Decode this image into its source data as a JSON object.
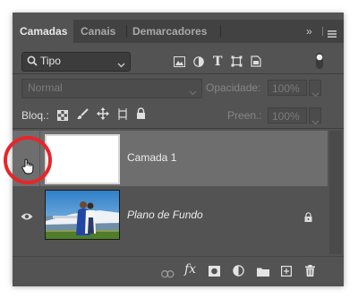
{
  "tabs": [
    {
      "label": "Camadas",
      "active": true
    },
    {
      "label": "Canais",
      "active": false
    },
    {
      "label": "Demarcadores",
      "active": false
    }
  ],
  "tab_controls": {
    "expand": "»",
    "menu_icon": "hamburger-menu-icon"
  },
  "filter": {
    "kind_label": "Tipo",
    "icons": [
      "image-filter-icon",
      "adjustment-filter-icon",
      "type-filter-icon",
      "shape-filter-icon",
      "smart-object-filter-icon",
      "filter-toggle-icon"
    ]
  },
  "blend": {
    "mode": "Normal",
    "opacity_label": "Opacidade:",
    "opacity_value": "100%"
  },
  "lock": {
    "label": "Bloq.:",
    "icons": [
      "lock-transparent-icon",
      "lock-image-icon",
      "lock-position-icon",
      "lock-artboard-icon",
      "lock-all-icon"
    ],
    "fill_label": "Preen.:",
    "fill_value": "100%"
  },
  "layers": [
    {
      "name": "Camada 1",
      "selected": true,
      "visible": true,
      "locked": false
    },
    {
      "name": "Plano de Fundo",
      "selected": false,
      "visible": true,
      "locked": true
    }
  ],
  "footer_icons": [
    "link-layers-icon",
    "fx-icon",
    "layer-mask-icon",
    "adjustment-layer-icon",
    "group-folder-icon",
    "new-layer-icon",
    "delete-layer-icon"
  ],
  "fx_label": "fx",
  "colors": {
    "annotation_ring": "#e8252a",
    "panel_bg": "#535353",
    "selected_row": "#6e6e6e"
  }
}
